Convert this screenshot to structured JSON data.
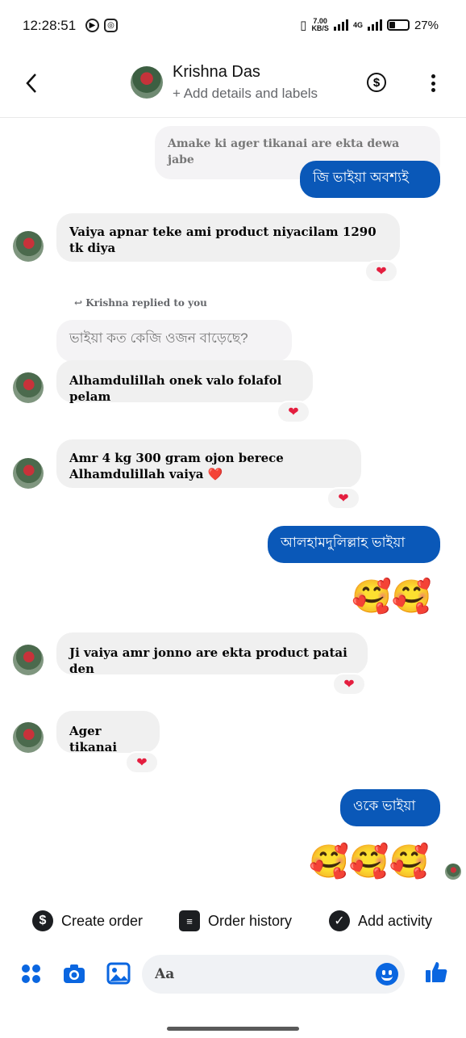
{
  "status_bar": {
    "time": "12:28:51",
    "net_speed_value": "7.00",
    "net_speed_unit": "KB/S",
    "network": "4G",
    "battery": "27%"
  },
  "header": {
    "contact_name": "Krishna Das",
    "subtitle": "+ Add details and labels",
    "icons": [
      "back-icon",
      "dollar-icon",
      "more-vert-icon"
    ]
  },
  "messages": [
    {
      "direction": "in",
      "text": "Amake ki ager tikanai are ekta dewa jabe"
    },
    {
      "direction": "out",
      "text": "জি ভাইয়া অবশ্যই"
    },
    {
      "direction": "in",
      "text": "Vaiya apnar teke ami product niyacilam 1290 tk diya",
      "reaction": "❤"
    },
    {
      "direction": "note",
      "text": "Krishna replied to you"
    },
    {
      "direction": "quoted",
      "text": "ভাইয়া কত কেজি ওজন বাড়েছে?"
    },
    {
      "direction": "in",
      "text": "Alhamdulillah onek valo folafol pelam",
      "reaction": "❤"
    },
    {
      "direction": "in",
      "text": "Amr 4 kg 300 gram ojon berece Alhamdulillah vaiya ❤️",
      "reaction": "❤"
    },
    {
      "direction": "out",
      "text": "আলহামদুলিল্লাহ ভাইয়া"
    },
    {
      "direction": "out-emoji",
      "text": "🥰🥰"
    },
    {
      "direction": "in",
      "text": "Ji vaiya amr jonno are ekta product patai den",
      "reaction": "❤"
    },
    {
      "direction": "in",
      "text": "Ager tikanai",
      "reaction": "❤"
    },
    {
      "direction": "out",
      "text": "ওকে ভাইয়া"
    },
    {
      "direction": "out-emoji",
      "text": "🥰🥰🥰"
    }
  ],
  "actions": {
    "create_order": "Create order",
    "order_history": "Order history",
    "add_activity": "Add activity"
  },
  "composer": {
    "placeholder": "Aa",
    "icons": [
      "apps-icon",
      "camera-icon",
      "gallery-icon",
      "emoji-icon",
      "like-icon"
    ]
  },
  "colors": {
    "outgoing_bubble": "#0a58b8",
    "incoming_bubble": "#f0f0f0",
    "reaction_heart": "#e41e3f",
    "accent": "#0a66e0"
  }
}
